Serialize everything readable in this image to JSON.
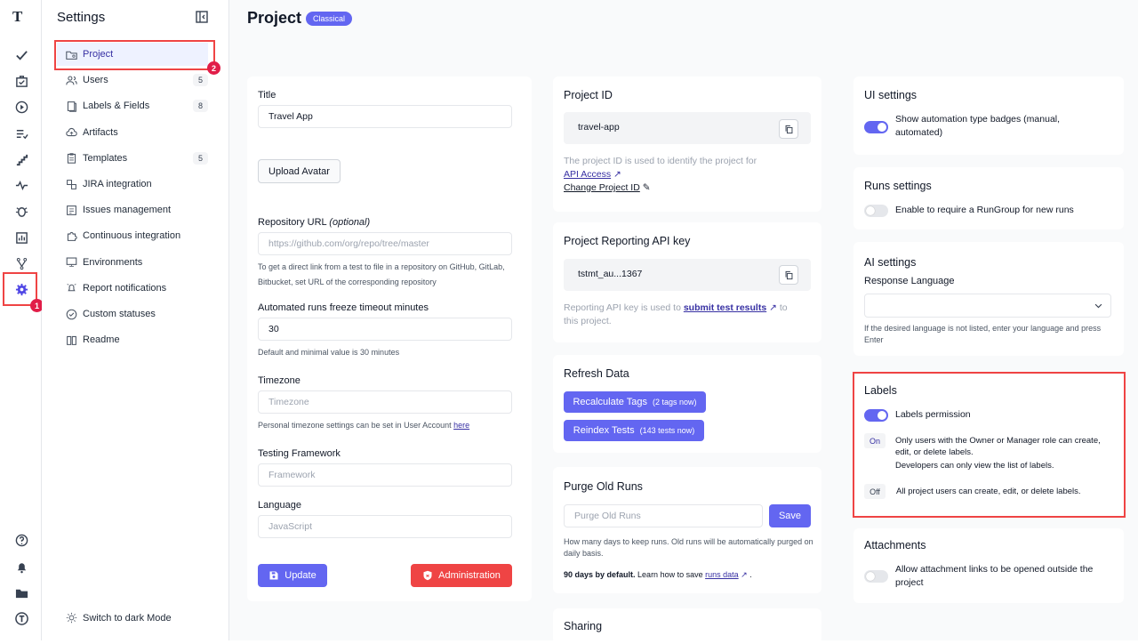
{
  "rail": {
    "items": [
      "check-icon",
      "briefcase-icon",
      "play-icon",
      "list-check-icon",
      "stairs-icon",
      "pulse-icon",
      "bug-icon",
      "chart-icon",
      "branch-icon",
      "gear-icon"
    ],
    "bottom": [
      "help-icon",
      "bell-icon",
      "folder-icon",
      "brand-icon"
    ],
    "marker": "1"
  },
  "sidebar": {
    "title": "Settings",
    "items": [
      {
        "label": "Project",
        "count": "",
        "icon": "project-folder-icon"
      },
      {
        "label": "Users",
        "count": "5",
        "icon": "users-icon"
      },
      {
        "label": "Labels & Fields",
        "count": "8",
        "icon": "labels-icon"
      },
      {
        "label": "Artifacts",
        "count": "",
        "icon": "cloud-icon"
      },
      {
        "label": "Templates",
        "count": "5",
        "icon": "clipboard-icon"
      },
      {
        "label": "JIRA integration",
        "count": "",
        "icon": "jira-icon"
      },
      {
        "label": "Issues management",
        "count": "",
        "icon": "issues-icon"
      },
      {
        "label": "Continuous integration",
        "count": "",
        "icon": "puzzle-icon"
      },
      {
        "label": "Environments",
        "count": "",
        "icon": "monitor-icon"
      },
      {
        "label": "Report notifications",
        "count": "",
        "icon": "notification-icon"
      },
      {
        "label": "Custom statuses",
        "count": "",
        "icon": "check-circle-icon"
      },
      {
        "label": "Readme",
        "count": "",
        "icon": "book-icon"
      }
    ],
    "marker": "2",
    "dark_mode": "Switch to dark Mode"
  },
  "header": {
    "title": "Project",
    "badge": "Classical"
  },
  "form": {
    "title_label": "Title",
    "title_value": "Travel App",
    "upload": "Upload Avatar",
    "repo_label": "Repository URL",
    "repo_optional": "(optional)",
    "repo_placeholder": "https://github.com/org/repo/tree/master",
    "repo_help": "To get a direct link from a test to file in a repository on GitHub, GitLab, Bitbucket, set URL of the corresponding repository",
    "freeze_label": "Automated runs freeze timeout minutes",
    "freeze_value": "30",
    "freeze_help": "Default and minimal value is 30 minutes",
    "tz_label": "Timezone",
    "tz_placeholder": "Timezone",
    "tz_help": "Personal timezone settings can be set in User Account",
    "tz_link": "here",
    "fw_label": "Testing Framework",
    "fw_placeholder": "Framework",
    "lang_label": "Language",
    "lang_placeholder": "JavaScript",
    "update": "Update",
    "admin": "Administration"
  },
  "project_id": {
    "title": "Project ID",
    "value": "travel-app",
    "help": "The project ID is used to identify the project for",
    "api_link": "API Access",
    "change_link": "Change Project ID"
  },
  "api_key": {
    "title": "Project Reporting API key",
    "value": "tstmt_au...1367",
    "help1": "Reporting API key is used to",
    "link": "submit test results",
    "help2": "to this project."
  },
  "refresh": {
    "title": "Refresh Data",
    "tags_btn": "Recalculate Tags",
    "tags_count": "(2 tags now)",
    "tests_btn": "Reindex Tests",
    "tests_count": "(143 tests now)"
  },
  "purge": {
    "title": "Purge Old Runs",
    "placeholder": "Purge Old Runs",
    "save": "Save",
    "help": "How many days to keep runs. Old runs will be automatically purged on daily basis.",
    "bold": "90 days by default.",
    "help2": "Learn how to save",
    "link": "runs data"
  },
  "sharing": {
    "title": "Sharing"
  },
  "ui_settings": {
    "title": "UI settings",
    "toggle_label": "Show automation type badges (manual, automated)",
    "on": true
  },
  "runs_settings": {
    "title": "Runs settings",
    "toggle_label": "Enable to require a RunGroup for new runs",
    "on": false
  },
  "ai_settings": {
    "title": "AI settings",
    "lang_label": "Response Language",
    "help": "If the desired language is not listed, enter your language and press Enter"
  },
  "labels": {
    "title": "Labels",
    "toggle_label": "Labels permission",
    "on": true,
    "on_tag": "On",
    "on_text1": "Only users with the Owner or Manager role can create, edit, or delete labels.",
    "on_text2": "Developers can only view the list of labels.",
    "off_tag": "Off",
    "off_text": "All project users can create, edit, or delete labels."
  },
  "attachments": {
    "title": "Attachments",
    "toggle_label": "Allow attachment links to be opened outside the project",
    "on": false
  },
  "colors": {
    "accent": "#6366f1",
    "danger": "#ef4444",
    "highlight": "#ef4444"
  }
}
